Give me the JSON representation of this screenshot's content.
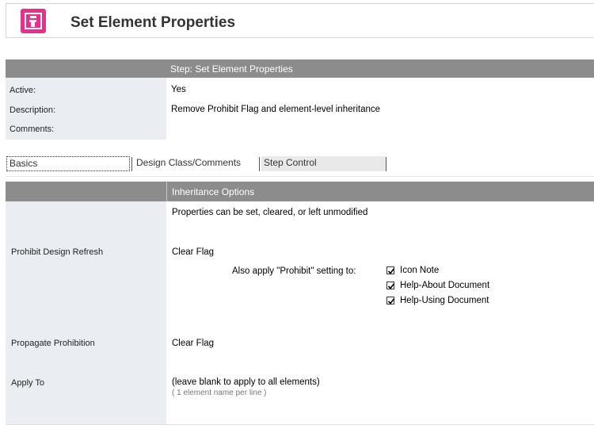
{
  "header": {
    "title": "Set Element Properties",
    "logo_icon": "agent-step-icon"
  },
  "step": {
    "bar_label": "Step:  Set Element Properties",
    "active_label": "Active:",
    "active_value": "Yes",
    "description_label": "Description:",
    "description_value": "Remove Prohibit Flag and element-level inheritance",
    "comments_label": "Comments:",
    "comments_value": ""
  },
  "tabs": [
    {
      "label": "Basics",
      "active": true
    },
    {
      "label": "Design Class/Comments",
      "active": false
    },
    {
      "label": "Step Control",
      "active": false
    }
  ],
  "inheritance": {
    "bar_label": "Inheritance Options",
    "intro": "Properties can be set, cleared, or left unmodified",
    "prohibit_label": "Prohibit Design Refresh",
    "prohibit_value": "Clear Flag",
    "also_apply": "Also apply \"Prohibit\" setting to:",
    "checkboxes": [
      {
        "label": "Icon Note",
        "checked": true
      },
      {
        "label": "Help-About Document",
        "checked": true
      },
      {
        "label": "Help-Using Document",
        "checked": true
      }
    ],
    "propagate_label": "Propagate Prohibition",
    "propagate_value": "Clear Flag",
    "apply_to_label": "Apply To",
    "apply_to_value": "(leave blank to apply to all elements)",
    "apply_to_hint": "( 1 element name per line )"
  },
  "colors": {
    "header_bar": "#8c8c8c",
    "label_column": "#eaeef3",
    "logo": "#e8308a"
  }
}
